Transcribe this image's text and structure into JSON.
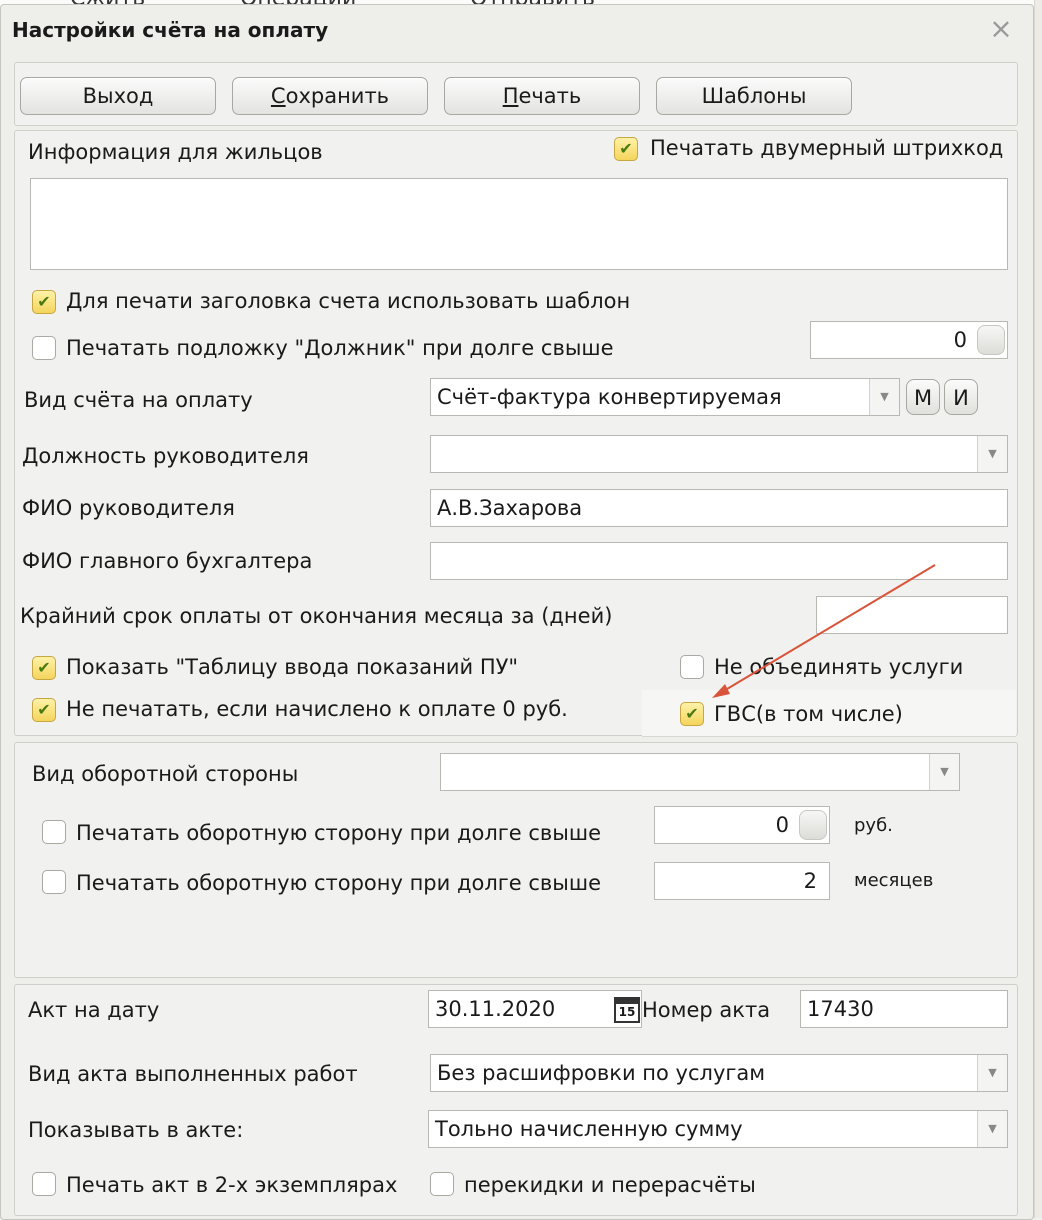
{
  "background": {
    "tab1": "Сжить",
    "tab2": "Операции",
    "tab3": "Отправить"
  },
  "window": {
    "title": "Настройки счёта на оплату",
    "close_icon": "close-icon"
  },
  "toolbar": {
    "exit_label": "Выход",
    "save_hot": "С",
    "save_rest": "охранить",
    "print_hot": "П",
    "print_rest": "ечать",
    "templates_label": "Шаблоны"
  },
  "info": {
    "label": "Информация для жильцов",
    "print_barcode_label": "Печатать двумерный штрихкод",
    "print_barcode_checked": true,
    "text": ""
  },
  "options": {
    "use_template_label": "Для печати заголовка счета использовать шаблон",
    "use_template_checked": true,
    "debtor_label": "Печатать подложку \"Должник\" при долге свыше",
    "debtor_checked": false,
    "debtor_value": "0"
  },
  "form": {
    "invoice_type_label": "Вид счёта на оплату",
    "invoice_type_value": "Счёт-фактура конвертируемая",
    "btn_m": "М",
    "btn_i": "И",
    "head_position_label": "Должность руководителя",
    "head_position_value": "",
    "head_name_label": "ФИО руководителя",
    "head_name_value": "А.В.Захарова",
    "accountant_label": "ФИО главного бухгалтера",
    "accountant_value": "",
    "deadline_label": "Крайний срок оплаты от окончания месяца за (дней)",
    "deadline_value": ""
  },
  "flags": {
    "show_table_label": "Показать \"Таблицу ввода показаний ПУ\"",
    "show_table_checked": true,
    "no_merge_label": "Не объединять услуги",
    "no_merge_checked": false,
    "no_print_zero_label": "Не печатать, если начислено к оплате 0 руб.",
    "no_print_zero_checked": true,
    "gvs_label": "ГВС(в том числе)",
    "gvs_checked": true
  },
  "reverse": {
    "type_label": "Вид оборотной стороны",
    "type_value": "",
    "debt_rub_label": "Печатать оборотную сторону при долге свыше",
    "debt_rub_checked": false,
    "debt_rub_value": "0",
    "debt_rub_unit": "руб.",
    "debt_months_label": "Печатать оборотную сторону при долге свыше",
    "debt_months_checked": false,
    "debt_months_value": "2",
    "debt_months_unit": "месяцев"
  },
  "act": {
    "date_label": "Акт на дату",
    "date_value": "30.11.2020",
    "calendar_day": "15",
    "number_label": "Номер акта",
    "number_value": "17430",
    "work_type_label": "Вид акта выполненных работ",
    "work_type_value": "Без расшифровки по услугам",
    "show_label": "Показывать в акте:",
    "show_value": "Тольно начисленную сумму",
    "two_copies_label": "Печать акт в 2-х экземплярах",
    "two_copies_checked": false,
    "recalc_label": "перекидки и перерасчёты",
    "recalc_checked": false
  },
  "colors": {
    "annotation_arrow": "#d9543a",
    "checkbox_on": "#f4d55c"
  }
}
